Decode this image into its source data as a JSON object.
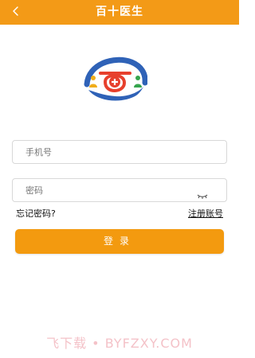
{
  "header": {
    "title": "百十医生",
    "back_icon": "chevron-left-icon"
  },
  "logo": {
    "icon": "medical-logo-icon"
  },
  "form": {
    "phone_placeholder": "手机号",
    "password_placeholder": "密码",
    "eye_icon": "eye-closed-icon",
    "forgot_label": "忘记密码?",
    "register_label": "注册账号",
    "login_label": "登录"
  },
  "watermark": "飞下载 • BYFZXY.COM",
  "colors": {
    "accent": "#f39a17",
    "logo_blue": "#2f62b7",
    "logo_red": "#e7402d",
    "logo_green": "#35a54d"
  }
}
